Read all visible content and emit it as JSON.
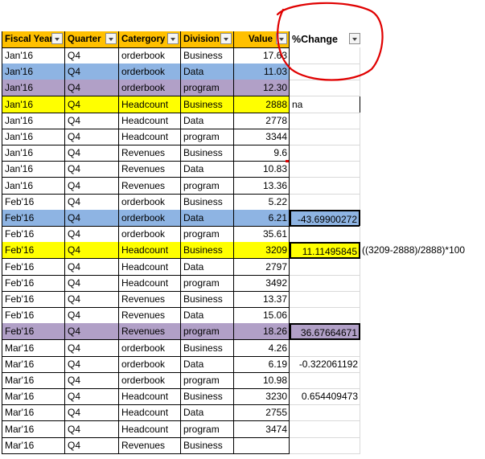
{
  "headers": [
    "Fiscal Year",
    "Quarter",
    "Catergory",
    "Division",
    "Value",
    "%Change"
  ],
  "colors": {
    "header_orange": "#ffc000",
    "highlight_blue": "#8eb4e3",
    "highlight_purple": "#b1a0c7",
    "highlight_yellow": "#ffff00",
    "annotation_red": "#e00000"
  },
  "rows": [
    {
      "fy": "Jan'16",
      "q": "Q4",
      "cat": "orderbook",
      "div": "Business",
      "val": "17.63",
      "chg": "",
      "hl": ""
    },
    {
      "fy": "Jan'16",
      "q": "Q4",
      "cat": "orderbook",
      "div": "Data",
      "val": "11.03",
      "chg": "",
      "hl": "blue"
    },
    {
      "fy": "Jan'16",
      "q": "Q4",
      "cat": "orderbook",
      "div": "program",
      "val": "12.30",
      "chg": "",
      "hl": "purple"
    },
    {
      "fy": "Jan'16",
      "q": "Q4",
      "cat": "Headcount",
      "div": "Business",
      "val": "2888",
      "chg": "na",
      "hl": "yellow"
    },
    {
      "fy": "Jan'16",
      "q": "Q4",
      "cat": "Headcount",
      "div": "Data",
      "val": "2778",
      "chg": "",
      "hl": ""
    },
    {
      "fy": "Jan'16",
      "q": "Q4",
      "cat": "Headcount",
      "div": "program",
      "val": "3344",
      "chg": "",
      "hl": ""
    },
    {
      "fy": "Jan'16",
      "q": "Q4",
      "cat": "Revenues",
      "div": "Business",
      "val": "9.6",
      "chg": "",
      "hl": ""
    },
    {
      "fy": "Jan'16",
      "q": "Q4",
      "cat": "Revenues",
      "div": "Data",
      "val": "10.83",
      "chg": "",
      "hl": ""
    },
    {
      "fy": "Jan'16",
      "q": "Q4",
      "cat": "Revenues",
      "div": "program",
      "val": "13.36",
      "chg": "",
      "hl": ""
    },
    {
      "fy": "Feb'16",
      "q": "Q4",
      "cat": "orderbook",
      "div": "Business",
      "val": "5.22",
      "chg": "",
      "hl": ""
    },
    {
      "fy": "Feb'16",
      "q": "Q4",
      "cat": "orderbook",
      "div": "Data",
      "val": "6.21",
      "chg": "-43.69900272",
      "hl": "blue"
    },
    {
      "fy": "Feb'16",
      "q": "Q4",
      "cat": "orderbook",
      "div": "program",
      "val": "35.61",
      "chg": "",
      "hl": ""
    },
    {
      "fy": "Feb'16",
      "q": "Q4",
      "cat": "Headcount",
      "div": "Business",
      "val": "3209",
      "chg": "11.11495845",
      "hl": "yellow",
      "note": "((3209-2888)/2888)*100"
    },
    {
      "fy": "Feb'16",
      "q": "Q4",
      "cat": "Headcount",
      "div": "Data",
      "val": "2797",
      "chg": "",
      "hl": ""
    },
    {
      "fy": "Feb'16",
      "q": "Q4",
      "cat": "Headcount",
      "div": "program",
      "val": "3492",
      "chg": "",
      "hl": ""
    },
    {
      "fy": "Feb'16",
      "q": "Q4",
      "cat": "Revenues",
      "div": "Business",
      "val": "13.37",
      "chg": "",
      "hl": ""
    },
    {
      "fy": "Feb'16",
      "q": "Q4",
      "cat": "Revenues",
      "div": "Data",
      "val": "15.06",
      "chg": "",
      "hl": ""
    },
    {
      "fy": "Feb'16",
      "q": "Q4",
      "cat": "Revenues",
      "div": "program",
      "val": "18.26",
      "chg": "36.67664671",
      "hl": "purple"
    },
    {
      "fy": "Mar'16",
      "q": "Q4",
      "cat": "orderbook",
      "div": "Business",
      "val": "4.26",
      "chg": "",
      "hl": ""
    },
    {
      "fy": "Mar'16",
      "q": "Q4",
      "cat": "orderbook",
      "div": "Data",
      "val": "6.19",
      "chg": "-0.322061192",
      "hl": ""
    },
    {
      "fy": "Mar'16",
      "q": "Q4",
      "cat": "orderbook",
      "div": "program",
      "val": "10.98",
      "chg": "",
      "hl": ""
    },
    {
      "fy": "Mar'16",
      "q": "Q4",
      "cat": "Headcount",
      "div": "Business",
      "val": "3230",
      "chg": "0.654409473",
      "hl": ""
    },
    {
      "fy": "Mar'16",
      "q": "Q4",
      "cat": "Headcount",
      "div": "Data",
      "val": "2755",
      "chg": "",
      "hl": ""
    },
    {
      "fy": "Mar'16",
      "q": "Q4",
      "cat": "Headcount",
      "div": "program",
      "val": "3474",
      "chg": "",
      "hl": ""
    },
    {
      "fy": "Mar'16",
      "q": "Q4",
      "cat": "Revenues",
      "div": "Business",
      "val": "",
      "chg": "",
      "hl": ""
    }
  ]
}
